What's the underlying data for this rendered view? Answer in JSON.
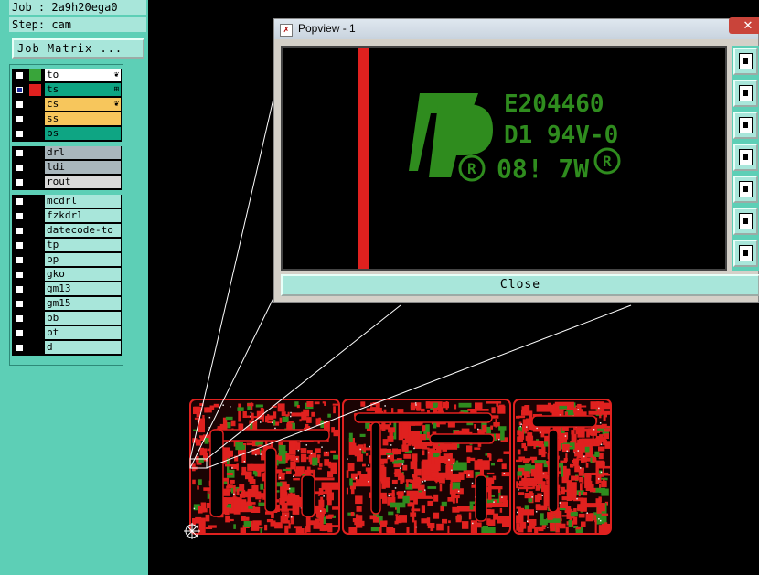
{
  "header": {
    "job_label": "Job : 2a9h20ega0",
    "step_label": "Step: cam"
  },
  "job_matrix_button": "Job Matrix ...",
  "layers_top": [
    {
      "name": "to",
      "color": "#39a53a",
      "selected": false,
      "mark": "❦",
      "fill": "#ffffff"
    },
    {
      "name": "ts",
      "color": "#e0211f",
      "selected": true,
      "mark": "⊞",
      "fill": "#0ea583"
    },
    {
      "name": "cs",
      "color": "#000000",
      "selected": false,
      "mark": "❦",
      "fill": "#f7c65c"
    },
    {
      "name": "ss",
      "color": "#000000",
      "selected": false,
      "mark": "",
      "fill": "#f7c65c"
    },
    {
      "name": "bs",
      "color": "#000000",
      "selected": false,
      "mark": "",
      "fill": "#0ea583"
    }
  ],
  "layers_drill": [
    {
      "name": "drl",
      "fill": "#a9b7bd"
    },
    {
      "name": "ldi",
      "fill": "#a9b7bd"
    },
    {
      "name": "rout",
      "fill": "#d9d9d9"
    }
  ],
  "layers_misc": [
    {
      "name": "mcdrl"
    },
    {
      "name": "fzkdrl"
    },
    {
      "name": "datecode-to"
    },
    {
      "name": "tp"
    },
    {
      "name": "bp"
    },
    {
      "name": "gko"
    },
    {
      "name": "gm13"
    },
    {
      "name": "gm15"
    },
    {
      "name": "pb"
    },
    {
      "name": "pt"
    },
    {
      "name": "d"
    }
  ],
  "popup": {
    "title": "Popview - 1",
    "close_label": "Close",
    "marking": {
      "line1": "E204460",
      "line2": "D1  94V-0",
      "line3": "08!  7W"
    }
  },
  "colors": {
    "panel": "#5dcfb6",
    "field": "#a8e6da",
    "pcb_red": "#e0211f",
    "pcb_green": "#2f8c1e"
  }
}
